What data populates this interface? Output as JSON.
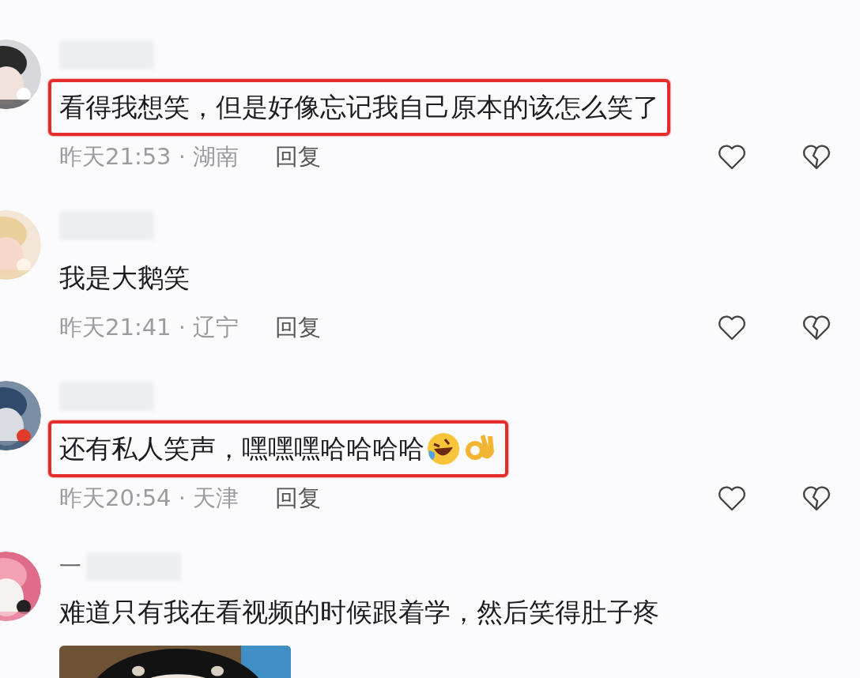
{
  "comments": [
    {
      "name_redacted": true,
      "text": "看得我想笑，但是好像忘记我自己原本的该怎么笑了",
      "highlighted": true,
      "meta": "昨天21:53 · 湖南",
      "reply": "回复"
    },
    {
      "name_redacted": true,
      "text": "我是大鹅笑",
      "highlighted": false,
      "meta": "昨天21:41 · 辽宁",
      "reply": "回复"
    },
    {
      "name_redacted": true,
      "text": "还有私人笑声，嘿嘿嘿哈哈哈哈",
      "trailing_icons": [
        {
          "kind": "laugh"
        },
        {
          "kind": "ok"
        }
      ],
      "highlighted": true,
      "meta": "昨天20:54 · 天津",
      "reply": "回复"
    },
    {
      "name_prefix": "一",
      "name_redacted": true,
      "text": "难道只有我在看视频的时候跟着学，然后笑得肚子疼",
      "highlighted": false
    }
  ]
}
